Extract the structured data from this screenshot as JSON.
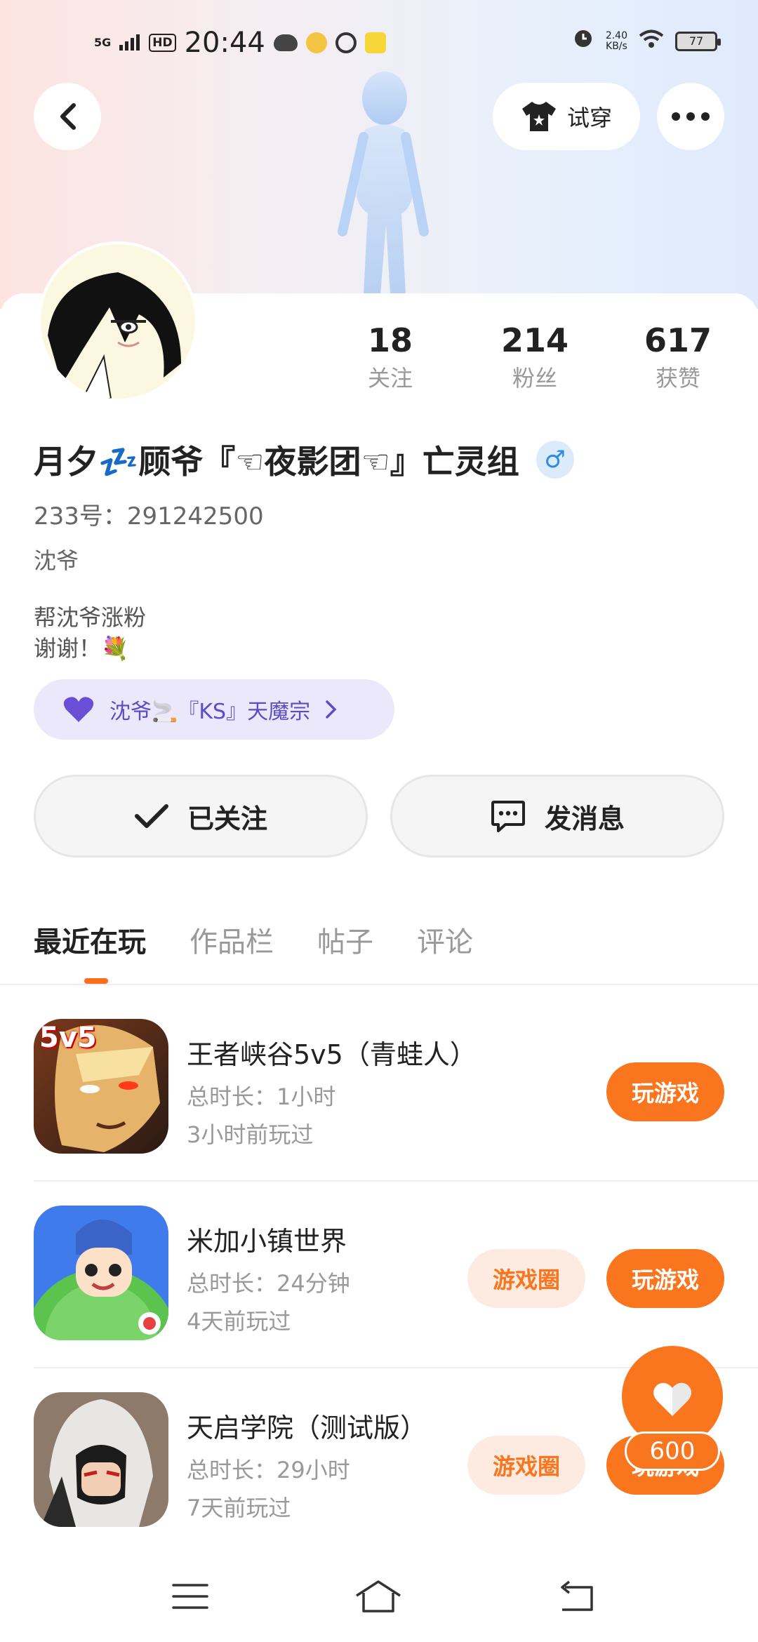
{
  "status_bar": {
    "signal": "5G",
    "hd": "HD",
    "time": "20:44",
    "speed_value": "2.40",
    "speed_unit": "KB/s",
    "battery": "77"
  },
  "header": {
    "try_on_label": "试穿"
  },
  "stats": [
    {
      "value": "18",
      "label": "关注"
    },
    {
      "value": "214",
      "label": "粉丝"
    },
    {
      "value": "617",
      "label": "获赞"
    }
  ],
  "profile": {
    "username": "月夕💤顾爷『☜夜影团☜』亡灵组",
    "gender_symbol": "♂",
    "uid": "233号：291242500",
    "subname": "沈爷",
    "bio_line1": "帮沈爷涨粉",
    "bio_line2": "谢谢！💐",
    "guild": "沈爷🚬『KS』天魔宗"
  },
  "actions": {
    "followed_label": "已关注",
    "message_label": "发消息"
  },
  "tabs": [
    "最近在玩",
    "作品栏",
    "帖子",
    "评论"
  ],
  "games": [
    {
      "title": "王者峡谷5v5（青蛙人）",
      "duration": "总时长：1小时",
      "last_played": "3小时前玩过",
      "play_label": "玩游戏",
      "icon_text": "5v5"
    },
    {
      "title": "米加小镇世界",
      "duration": "总时长：24分钟",
      "last_played": "4天前玩过",
      "circle_label": "游戏圈",
      "play_label": "玩游戏"
    },
    {
      "title": "天启学院（测试版）",
      "duration": "总时长：29小时",
      "last_played": "7天前玩过",
      "circle_label": "游戏圈",
      "play_label": "玩游戏"
    }
  ],
  "fab": {
    "count": "600"
  },
  "colors": {
    "accent": "#f9751e",
    "guild_bg": "#ebe8fb",
    "guild_text": "#5a4dc8"
  }
}
